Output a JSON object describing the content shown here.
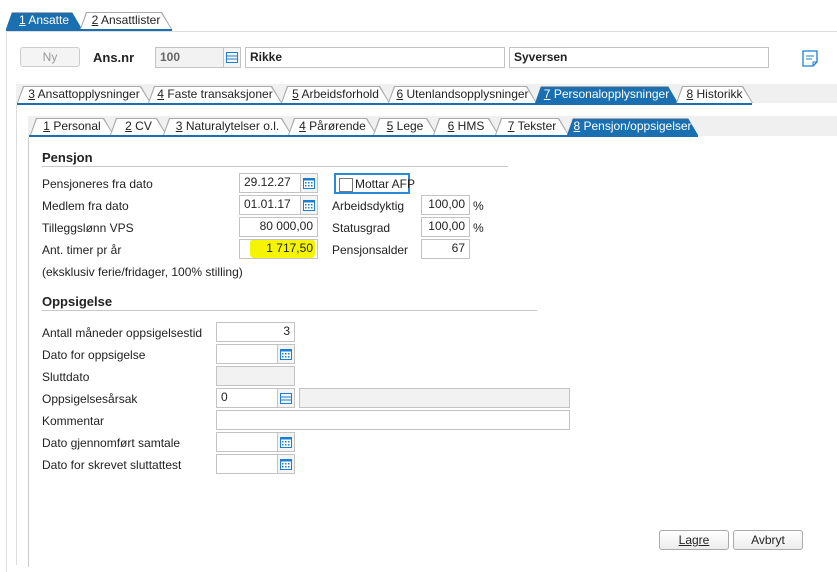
{
  "top_tabs": [
    {
      "num": "1",
      "label": "Ansatte",
      "active": true
    },
    {
      "num": "2",
      "label": "Ansattlister",
      "active": false
    }
  ],
  "header": {
    "new_button": "Ny",
    "ansnr_label": "Ans.nr",
    "ansnr_value": "100",
    "first_name": "Rikke",
    "last_name": "Syversen"
  },
  "main_tabs": [
    {
      "num": "3",
      "label": "Ansattopplysninger"
    },
    {
      "num": "4",
      "label": "Faste transaksjoner"
    },
    {
      "num": "5",
      "label": "Arbeidsforhold"
    },
    {
      "num": "6",
      "label": "Utenlandsopplysninger"
    },
    {
      "num": "7",
      "label": "Personalopplysninger",
      "active": true
    },
    {
      "num": "8",
      "label": "Historikk"
    }
  ],
  "sub_tabs": [
    {
      "num": "1",
      "label": "Personal"
    },
    {
      "num": "2",
      "label": "CV"
    },
    {
      "num": "3",
      "label": "Naturalytelser o.l."
    },
    {
      "num": "4",
      "label": "Pårørende"
    },
    {
      "num": "5",
      "label": "Lege"
    },
    {
      "num": "6",
      "label": "HMS"
    },
    {
      "num": "7",
      "label": "Tekster"
    },
    {
      "num": "8",
      "label": "Pensjon/oppsigelser",
      "active": true
    }
  ],
  "pensjon": {
    "heading": "Pensjon",
    "pensjoneres_label": "Pensjoneres fra dato",
    "pensjoneres_value": "29.12.27",
    "medlem_label": "Medlem fra dato",
    "medlem_value": "01.01.17",
    "tillegg_label": "Tilleggslønn VPS",
    "tillegg_value": "80 000,00",
    "timer_label": "Ant. timer pr år",
    "timer_value": "1 717,50",
    "note": "(eksklusiv ferie/fridager, 100% stilling)",
    "afp_label": "Mottar AFP",
    "afp_checked": false,
    "arbeidsdyktig_label": "Arbeidsdyktig",
    "arbeidsdyktig_value": "100,00",
    "statusgrad_label": "Statusgrad",
    "statusgrad_value": "100,00",
    "percent": "%",
    "pensjonsalder_label": "Pensjonsalder",
    "pensjonsalder_value": "67"
  },
  "oppsigelse": {
    "heading": "Oppsigelse",
    "maaneder_label": "Antall måneder oppsigelsestid",
    "maaneder_value": "3",
    "dato_label": "Dato for oppsigelse",
    "dato_value": "",
    "sluttdato_label": "Sluttdato",
    "sluttdato_value": "",
    "aarsak_label": "Oppsigelsesårsak",
    "aarsak_value": "0",
    "aarsak_desc": "",
    "kommentar_label": "Kommentar",
    "kommentar_value": "",
    "samtale_label": "Dato gjennomført samtale",
    "samtale_value": "",
    "sluttattest_label": "Dato for skrevet sluttattest",
    "sluttattest_value": ""
  },
  "footer": {
    "save": "Lagre",
    "cancel": "Avbryt"
  },
  "colors": {
    "accent": "#1a6fb0",
    "highlight": "#ffff00"
  }
}
